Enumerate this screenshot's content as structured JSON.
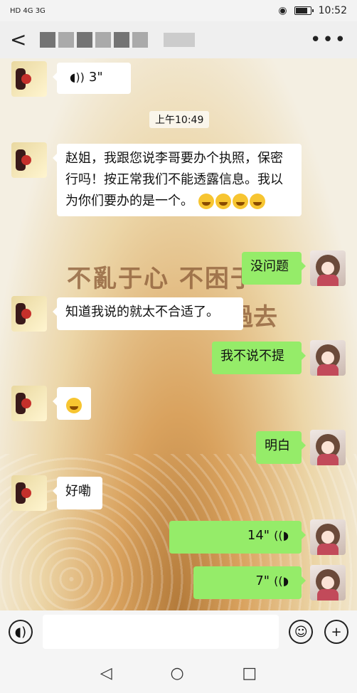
{
  "status_bar": {
    "left": "HD 4G 3G",
    "time": "10:52"
  },
  "nav": {
    "back": "<",
    "more": "•••"
  },
  "chat": {
    "voice_msg_in": {
      "duration": "3\""
    },
    "time_label": "上午10:49",
    "msg1": "赵姐，我跟您说李哥要办个执照，保密行吗！按正常我们不能透露信息。我以为你们要办的是一个。",
    "watermark_line1": "不亂于心 不困于",
    "watermark_line2": "過去",
    "msg_out1": "没问题",
    "msg2": "知道我说的就太不合适了。",
    "msg_out2": "我不说不提",
    "msg_out3": "明白",
    "msg3": "好嘞",
    "voice_out1": {
      "duration": "14\""
    },
    "voice_out2": {
      "duration": "7\""
    }
  },
  "icons": {
    "voice": "voice-input-icon",
    "emoji": "emoji-icon",
    "plus": "plus-icon"
  },
  "sys_nav": {
    "back": "◁",
    "home": "○",
    "recent": "□"
  }
}
